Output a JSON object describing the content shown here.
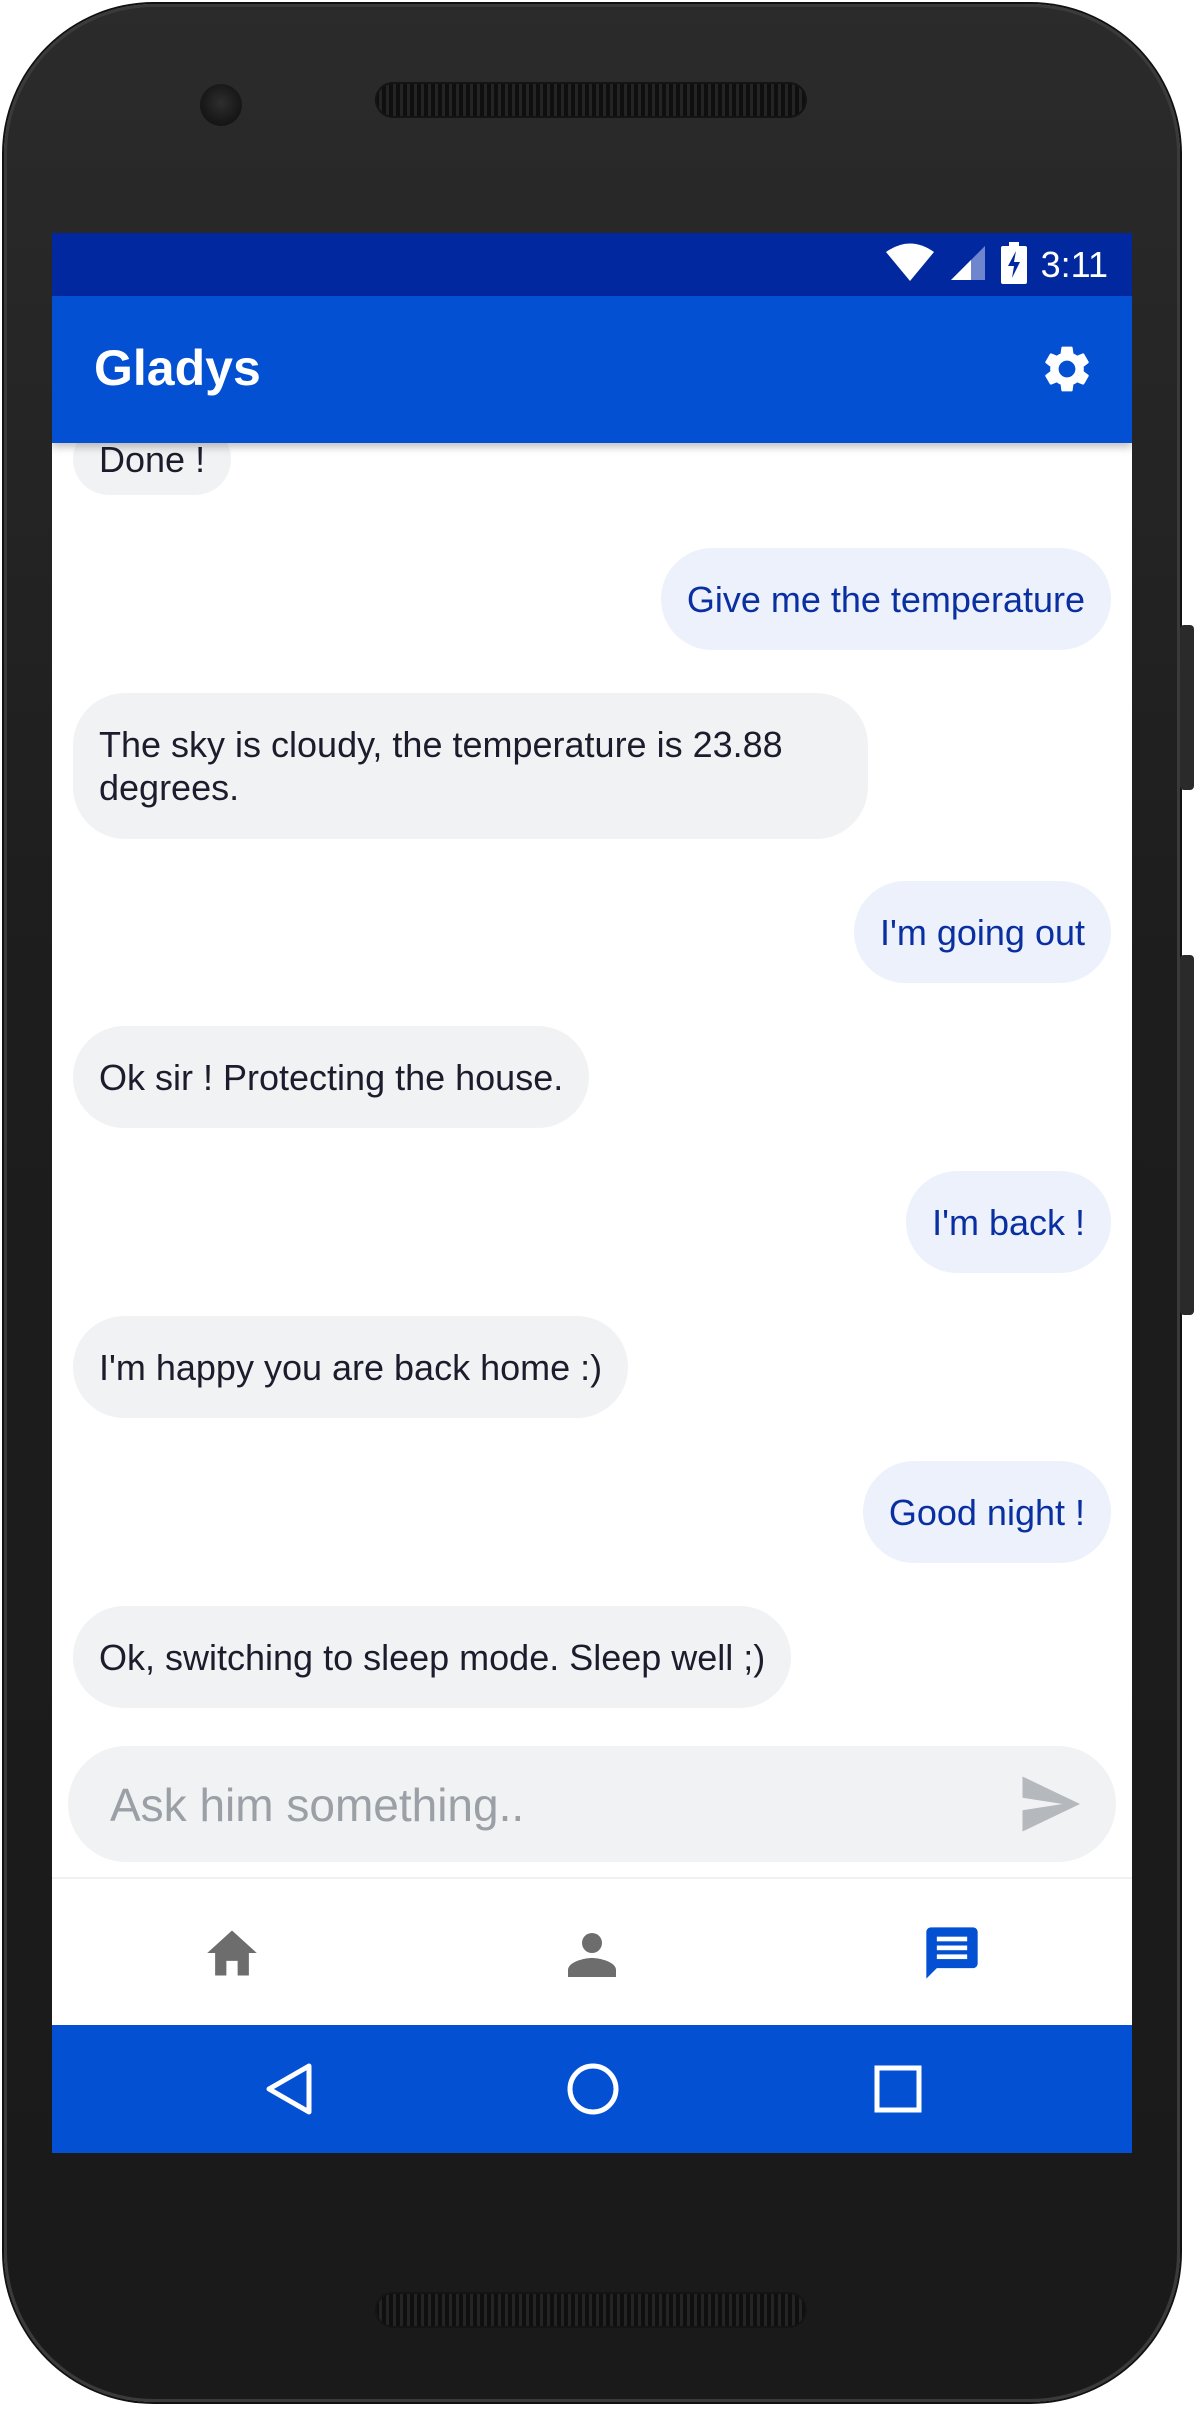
{
  "status_bar": {
    "time": "3:11"
  },
  "app_bar": {
    "title": "Gladys"
  },
  "messages": [
    {
      "from": "bot",
      "text": "Done !"
    },
    {
      "from": "user",
      "text": "Give me the temperature"
    },
    {
      "from": "bot",
      "text": "The sky is cloudy, the temperature is 23.88 degrees."
    },
    {
      "from": "user",
      "text": "I'm going out"
    },
    {
      "from": "bot",
      "text": "Ok sir ! Protecting the house."
    },
    {
      "from": "user",
      "text": "I'm back !"
    },
    {
      "from": "bot",
      "text": "I'm happy you are back home :)"
    },
    {
      "from": "user",
      "text": "Good night !"
    },
    {
      "from": "bot",
      "text": "Ok, switching to sleep mode. Sleep well ;)"
    }
  ],
  "input": {
    "placeholder": "Ask him something..",
    "value": ""
  },
  "bottom_nav": {
    "items": [
      {
        "icon": "home-icon",
        "active": false
      },
      {
        "icon": "person-icon",
        "active": false
      },
      {
        "icon": "chat-icon",
        "active": true
      }
    ]
  },
  "colors": {
    "status_bar": "#0228a0",
    "primary": "#0350d3",
    "bot_bubble": "#f1f2f4",
    "user_bubble": "#ecf1fc",
    "user_text": "#0a2fa0",
    "nav_inactive": "#6d6d6d",
    "nav_active": "#0350d3"
  }
}
